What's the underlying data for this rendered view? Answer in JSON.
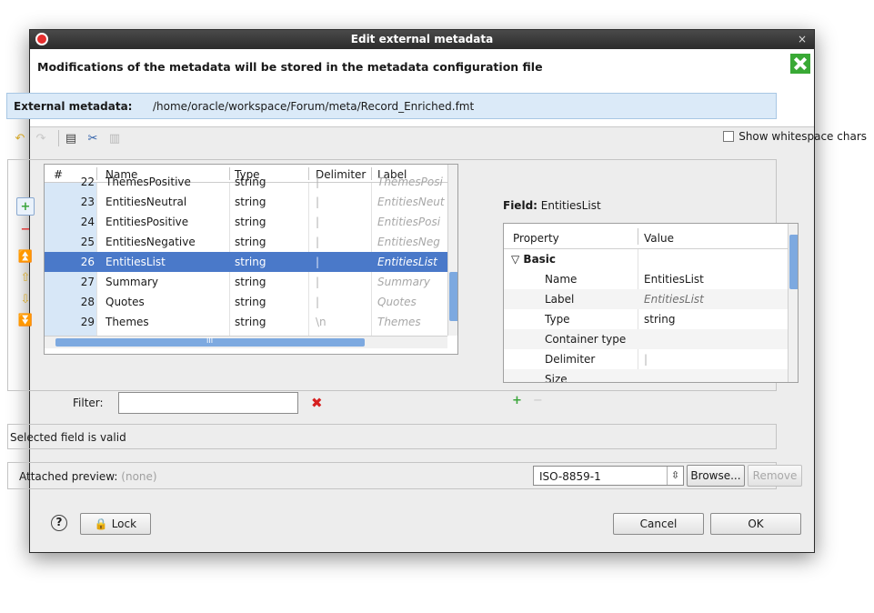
{
  "window": {
    "title": "Edit external metadata",
    "close_glyph": "×",
    "icon": "app-icon",
    "logo": "cloveretl-logo"
  },
  "header": {
    "message": "Modifications of the metadata will be stored in the metadata configuration file"
  },
  "external": {
    "label": "External metadata:",
    "path": "/home/oracle/workspace/Forum/meta/Record_Enriched.fmt"
  },
  "toolbar": {
    "icons": [
      "undo-icon",
      "redo-icon",
      "copy-icon",
      "cut-icon",
      "paste-icon"
    ],
    "show_whitespace_label": "Show whitespace chars"
  },
  "table": {
    "columns": [
      "#",
      "Name",
      "Type",
      "Delimiter",
      "Label"
    ],
    "rows": [
      {
        "num": "22",
        "name": "ThemesPositive",
        "type": "string",
        "delimiter": "|",
        "label": "ThemesPosi"
      },
      {
        "num": "23",
        "name": "EntitiesNeutral",
        "type": "string",
        "delimiter": "|",
        "label": "EntitiesNeut"
      },
      {
        "num": "24",
        "name": "EntitiesPositive",
        "type": "string",
        "delimiter": "|",
        "label": "EntitiesPosi"
      },
      {
        "num": "25",
        "name": "EntitiesNegative",
        "type": "string",
        "delimiter": "|",
        "label": "EntitiesNeg"
      },
      {
        "num": "26",
        "name": "EntitiesList",
        "type": "string",
        "delimiter": "|",
        "label": "EntitiesList"
      },
      {
        "num": "27",
        "name": "Summary",
        "type": "string",
        "delimiter": "|",
        "label": "Summary"
      },
      {
        "num": "28",
        "name": "Quotes",
        "type": "string",
        "delimiter": "|",
        "label": "Quotes"
      },
      {
        "num": "29",
        "name": "Themes",
        "type": "string",
        "delimiter": "\\n",
        "label": "Themes"
      }
    ],
    "selected_row": "26",
    "scroll_mark": "III"
  },
  "filter": {
    "label": "Filter:",
    "value": "",
    "clear_icon": "red-x-icon"
  },
  "field": {
    "label": "Field:",
    "name": "EntitiesList"
  },
  "properties": {
    "header_property": "Property",
    "header_value": "Value",
    "group": "Basic",
    "rows": [
      {
        "property": "Name",
        "value": "EntitiesList"
      },
      {
        "property": "Label",
        "value": "EntitiesList"
      },
      {
        "property": "Type",
        "value": "string"
      },
      {
        "property": "Container type",
        "value": ""
      },
      {
        "property": "Delimiter",
        "value": "|"
      },
      {
        "property": "Size",
        "value": ""
      }
    ]
  },
  "status": {
    "text": "Selected field is valid"
  },
  "preview": {
    "label": "Attached preview:",
    "value": "(none)",
    "encoding": "ISO-8859-1",
    "browse_label": "Browse...",
    "remove_label": "Remove"
  },
  "footer": {
    "help_glyph": "?",
    "lock_label": "Lock",
    "cancel_label": "Cancel",
    "ok_label": "OK"
  },
  "colors": {
    "selection": "#4a79c9",
    "info_bar": "#dbeaf8",
    "add_green": "#3aa53a",
    "remove_red": "#e03b3b",
    "scroll_thumb": "#7da9e0"
  }
}
